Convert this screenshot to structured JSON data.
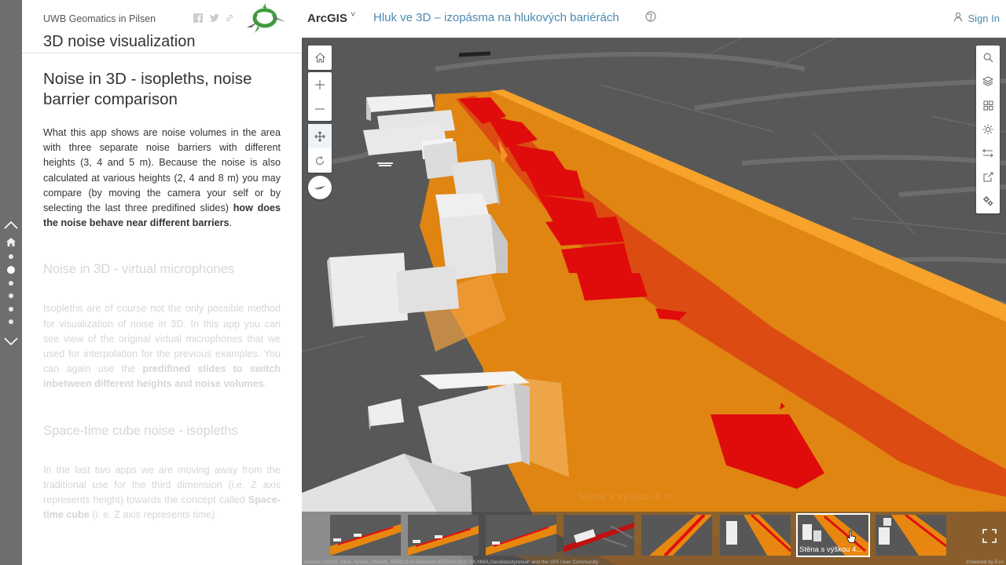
{
  "story": {
    "org": "UWB Geomatics in Pilsen",
    "app_title": "3D noise visualization",
    "sections": [
      {
        "title": "Noise in 3D - isopleths, noise barrier comparison",
        "text_plain": "What this app shows are noise volumes in the area with three separate noise barriers with different heights (3, 4 and 5 m). Because the noise is also calculated at various heights (2, 4 and 8 m) you may compare (by moving the camera your self or by selecting the last three predifined slides) ",
        "text_bold": "how does the noise behave near different barriers",
        "text_end": "."
      },
      {
        "title": "Noise in 3D - virtual microphones",
        "text_plain": "Isopleths are of course not the only possible method for visualization of noise in 3D. In this app you can see view of the original virtual microphones that we used for interpolation for the previous examples. You can again use the ",
        "text_bold": "predifined slides to switch inbetween different heights and noise volumes",
        "text_end": "."
      },
      {
        "title": "Space-time cube noise - isopleths",
        "text_plain": "In the last two apps we are moving away from the traditional use for the third dimension (i.e. Z axis represents height) towards the concept called ",
        "text_bold": "Space-time cube",
        "text_end": " (i. e. Z axis represents time)."
      }
    ]
  },
  "topbar": {
    "brand": "ArcGIS",
    "brand_caret": "˅",
    "map_title": "Hluk ve 3D – izopásma na hlukových bariérách",
    "sign_in": "Sign In"
  },
  "map": {
    "ghost_label": "Stěna s výškou 4 m",
    "slides": [
      {
        "label": ""
      },
      {
        "label": ""
      },
      {
        "label": ""
      },
      {
        "label": ""
      },
      {
        "label": ""
      },
      {
        "label": ""
      },
      {
        "label": "Stěna s výškou 4..."
      },
      {
        "label": ""
      }
    ],
    "attribution": "Source: USGS, NGA, NASA, CGIAR, GEBCO,N Robinson,NCEAS,NLS,OS,NMA,Geodatastyrelsen and the GIS User Community",
    "powered_by": "Powered by Esri"
  },
  "colors": {
    "noise_orange": "#f0900f",
    "noise_red": "#e00b0b",
    "basemap": "#585858",
    "link_blue": "#4a8ab0"
  },
  "icons": {
    "left_tools": [
      "home-icon",
      "zoom-in-icon",
      "zoom-out-icon",
      "pan-icon",
      "rotate-icon",
      "compass-icon"
    ],
    "right_tools": [
      "search-icon",
      "layers-icon",
      "basemap-gallery-icon",
      "daylight-icon",
      "measure-icon",
      "share-icon",
      "settings-icon"
    ]
  }
}
